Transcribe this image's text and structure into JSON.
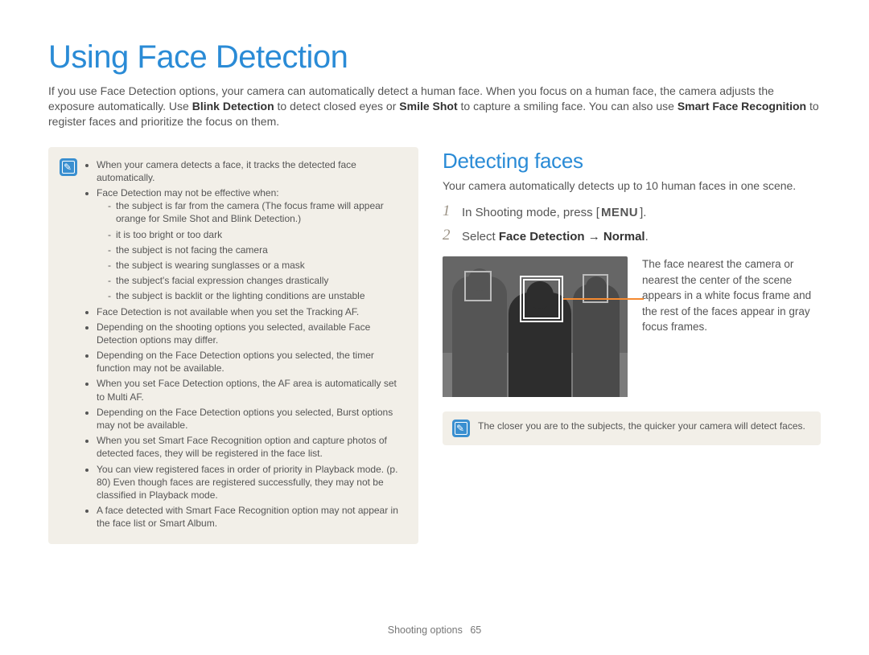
{
  "title": "Using Face Detection",
  "intro": {
    "part1": "If you use Face Detection options, your camera can automatically detect a human face. When you focus on a human face, the camera adjusts the exposure automatically. Use ",
    "bold1": "Blink Detection",
    "part2": " to detect closed eyes or ",
    "bold2": "Smile Shot",
    "part3": " to capture a smiling face. You can also use ",
    "bold3": "Smart Face Recognition",
    "part4": " to register faces and prioritize the focus on them."
  },
  "left_note": {
    "bullets": [
      "When your camera detects a face, it tracks the detected face automatically.",
      "Face Detection may not be effective when:"
    ],
    "sub_bullets": [
      "the subject is far from the camera (The focus frame will appear orange for Smile Shot and Blink Detection.)",
      "it is too bright or too dark",
      "the subject is not facing the camera",
      "the subject is wearing sunglasses or a mask",
      "the subject's facial expression changes drastically",
      "the subject is backlit or the lighting conditions are unstable"
    ],
    "bullets_after": [
      "Face Detection is not available when you set the Tracking AF.",
      "Depending on the shooting options you selected, available Face Detection options may differ.",
      "Depending on the Face Detection options you selected, the timer function may not be available.",
      "When you set Face Detection options, the AF area is automatically set to Multi AF.",
      "Depending on the Face Detection options you selected, Burst options may not be available.",
      "When you set Smart Face Recognition option and capture photos of detected faces, they will be registered in the face list.",
      "You can view registered faces in order of priority in Playback mode. (p. 80) Even though faces are registered successfully, they may not be classified in Playback mode.",
      "A face detected with Smart Face Recognition option may not appear in the face list or Smart Album."
    ]
  },
  "right": {
    "heading": "Detecting faces",
    "intro": "Your camera automatically detects up to 10 human faces in one scene.",
    "steps": [
      {
        "num": "1",
        "pre": "In Shooting mode, press [",
        "button": "MENU",
        "post": "]."
      },
      {
        "num": "2",
        "pre": "Select ",
        "bold": "Face Detection → Normal",
        "post": "."
      }
    ],
    "caption": "The face nearest the camera or nearest the center of the scene appears in a white focus frame and the rest of the faces appear in gray focus frames.",
    "note": "The closer you are to the subjects, the quicker your camera will detect faces."
  },
  "footer": {
    "section": "Shooting options",
    "page": "65"
  }
}
